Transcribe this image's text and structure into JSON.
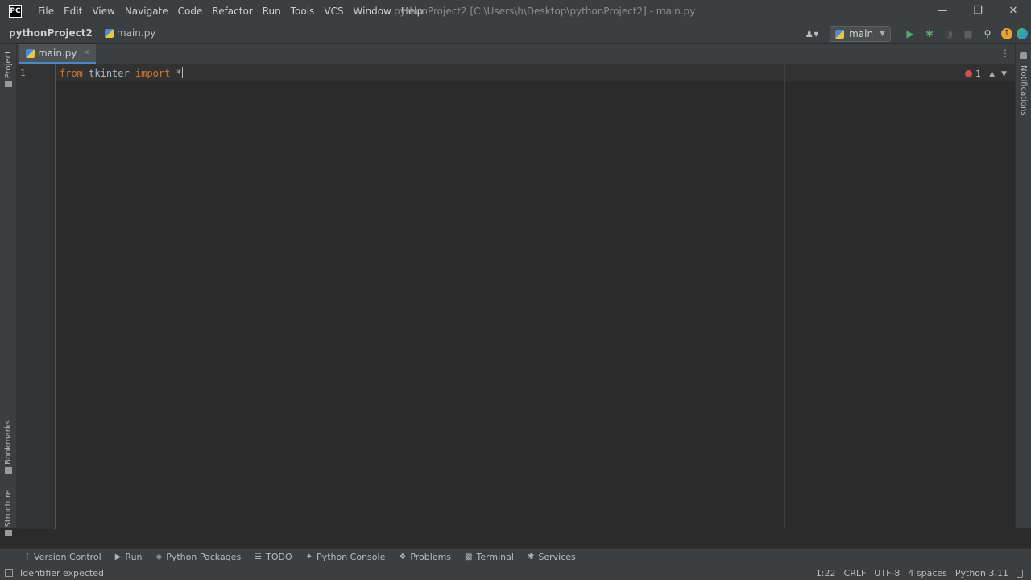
{
  "app": {
    "logo_text": "PC",
    "menu": [
      "File",
      "Edit",
      "View",
      "Navigate",
      "Code",
      "Refactor",
      "Run",
      "Tools",
      "VCS",
      "Window",
      "Help"
    ],
    "window_title": "pythonProject2 [C:\\Users\\h\\Desktop\\pythonProject2] - main.py",
    "controls": {
      "minimize": "—",
      "restore": "❐",
      "close": "✕"
    }
  },
  "nav": {
    "project": "pythonProject2",
    "file": "main.py",
    "run_config": "main"
  },
  "left_tools": [
    "Project",
    "Bookmarks",
    "Structure"
  ],
  "right_tools": [
    "Notifications"
  ],
  "editor": {
    "tab_label": "main.py",
    "line_number": "1",
    "code": {
      "kw1": "from",
      "module": "tkinter",
      "kw2": "import",
      "star": "*"
    },
    "error_count": "1"
  },
  "bottom_tools": [
    {
      "label": "Version Control",
      "icon": "branch-icon"
    },
    {
      "label": "Run",
      "icon": "play-icon"
    },
    {
      "label": "Python Packages",
      "icon": "layers-icon"
    },
    {
      "label": "TODO",
      "icon": "list-icon"
    },
    {
      "label": "Python Console",
      "icon": "python-icon"
    },
    {
      "label": "Problems",
      "icon": "info-icon"
    },
    {
      "label": "Terminal",
      "icon": "terminal-icon"
    },
    {
      "label": "Services",
      "icon": "services-icon"
    }
  ],
  "status": {
    "message": "Identifier expected",
    "position": "1:22",
    "line_sep": "CRLF",
    "encoding": "UTF-8",
    "indent": "4 spaces",
    "interpreter": "Python 3.11"
  },
  "colors": {
    "keyword": "#cc7832",
    "text": "#a9b7c6",
    "error": "#c75450",
    "run": "#59a869",
    "accent": "#4a88c7"
  }
}
